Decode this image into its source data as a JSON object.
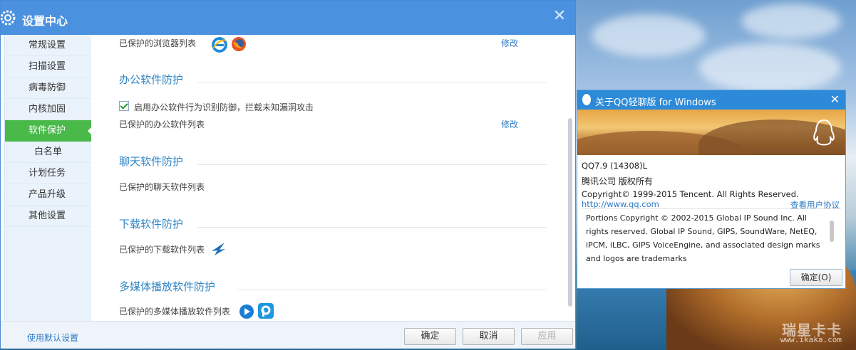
{
  "window": {
    "title": "设置中心"
  },
  "sidebar": {
    "items": [
      {
        "label": "常规设置",
        "active": false,
        "sub": false
      },
      {
        "label": "扫描设置",
        "active": false,
        "sub": false
      },
      {
        "label": "病毒防御",
        "active": false,
        "sub": false
      },
      {
        "label": "内核加固",
        "active": false,
        "sub": false
      },
      {
        "label": "软件保护",
        "active": true,
        "sub": false
      },
      {
        "label": "白名单",
        "active": false,
        "sub": true
      },
      {
        "label": "计划任务",
        "active": false,
        "sub": false
      },
      {
        "label": "产品升级",
        "active": false,
        "sub": false
      },
      {
        "label": "其他设置",
        "active": false,
        "sub": false
      }
    ]
  },
  "content": {
    "browser_list_label": "已保护的浏览器列表",
    "modify_label": "修改",
    "office_section": "办公软件防护",
    "office_checkbox_label": "启用办公软件行为识别防御，拦截未知漏洞攻击",
    "office_checkbox_checked": true,
    "office_list_label": "已保护的办公软件列表",
    "chat_section": "聊天软件防护",
    "chat_list_label": "已保护的聊天软件列表",
    "download_section": "下载软件防护",
    "download_list_label": "已保护的下载软件列表",
    "media_section": "多媒体播放软件防护",
    "media_list_label": "已保护的多媒体播放软件列表"
  },
  "footer": {
    "default_link": "使用默认设置",
    "ok": "确定",
    "cancel": "取消",
    "apply": "应用"
  },
  "qq_dialog": {
    "title": "关于QQ轻聊版 for Windows",
    "version": "QQ7.9 (14308)L",
    "company": "腾讯公司 版权所有",
    "copyright": "Copyright© 1999-2015 Tencent. All Rights Reserved.",
    "url": "http://www.qq.com",
    "agreement_link": "查看用户协议",
    "portions_text": "Portions Copyright © 2002-2015 Global IP Sound Inc. All rights reserved. Global IP Sound, GIPS, SoundWare, NetEQ, iPCM, iLBC, GIPS VoiceEngine, and associated design marks and logos are trademarks",
    "ok_button": "确定(O)"
  },
  "watermark": {
    "line1": "瑞星卡卡",
    "line2": "www.ikaka.com"
  },
  "colors": {
    "accent": "#4a92e0",
    "active_green": "#49b94a",
    "link": "#2d7ac6",
    "section": "#2f86c6"
  }
}
